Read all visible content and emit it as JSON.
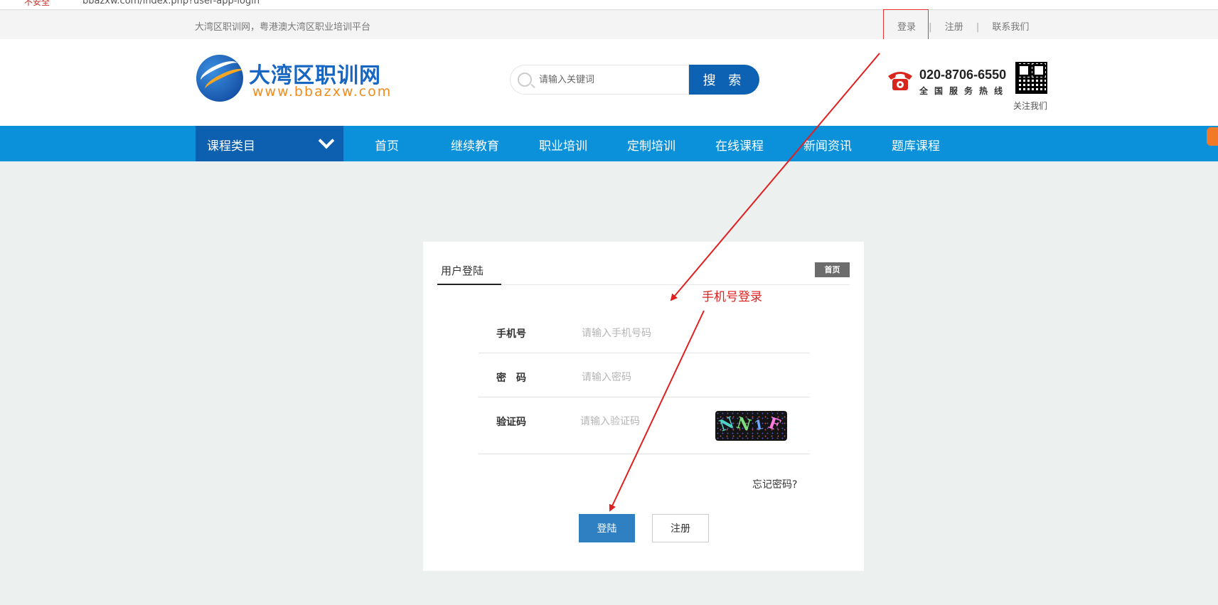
{
  "browser": {
    "security_warning": "不安全",
    "url": "bbazxw.com/index.php?user-app-login"
  },
  "topbar": {
    "slogan": "大湾区职训网，粤港澳大湾区职业培训平台",
    "links": [
      "登录",
      "注册",
      "联系我们"
    ],
    "separator": "|"
  },
  "header": {
    "logo_title": "大湾区职训网",
    "logo_url": "www.bbazxw.com",
    "search_placeholder": "请输入关键词",
    "search_button": "搜 索",
    "phone_number": "020-8706-6550",
    "phone_label": "全国服务热线",
    "qr_label": "关注我们"
  },
  "nav": {
    "category": "课程类目",
    "items": [
      "首页",
      "继续教育",
      "职业培训",
      "定制培训",
      "在线课程",
      "新闻资讯",
      "题库课程"
    ]
  },
  "login": {
    "tab": "用户登陆",
    "home_badge": "首页",
    "fields": [
      {
        "label": "手机号",
        "placeholder": "请输入手机号码"
      },
      {
        "label": "密　码",
        "placeholder": "请输入密码"
      },
      {
        "label": "验证码",
        "placeholder": "请输入验证码"
      }
    ],
    "captcha_chars": [
      "N",
      "N",
      "1",
      "F"
    ],
    "forgot": "忘记密码?",
    "login_button": "登陆",
    "register_button": "注册"
  },
  "annotation": {
    "text": "手机号登录",
    "color": "#e02020"
  },
  "colors": {
    "nav_bg": "#0a91da",
    "category_bg": "#0d5fb0",
    "search_button": "#0e62b3",
    "login_button": "#2f80c2",
    "logo_orange": "#f08c1e"
  }
}
